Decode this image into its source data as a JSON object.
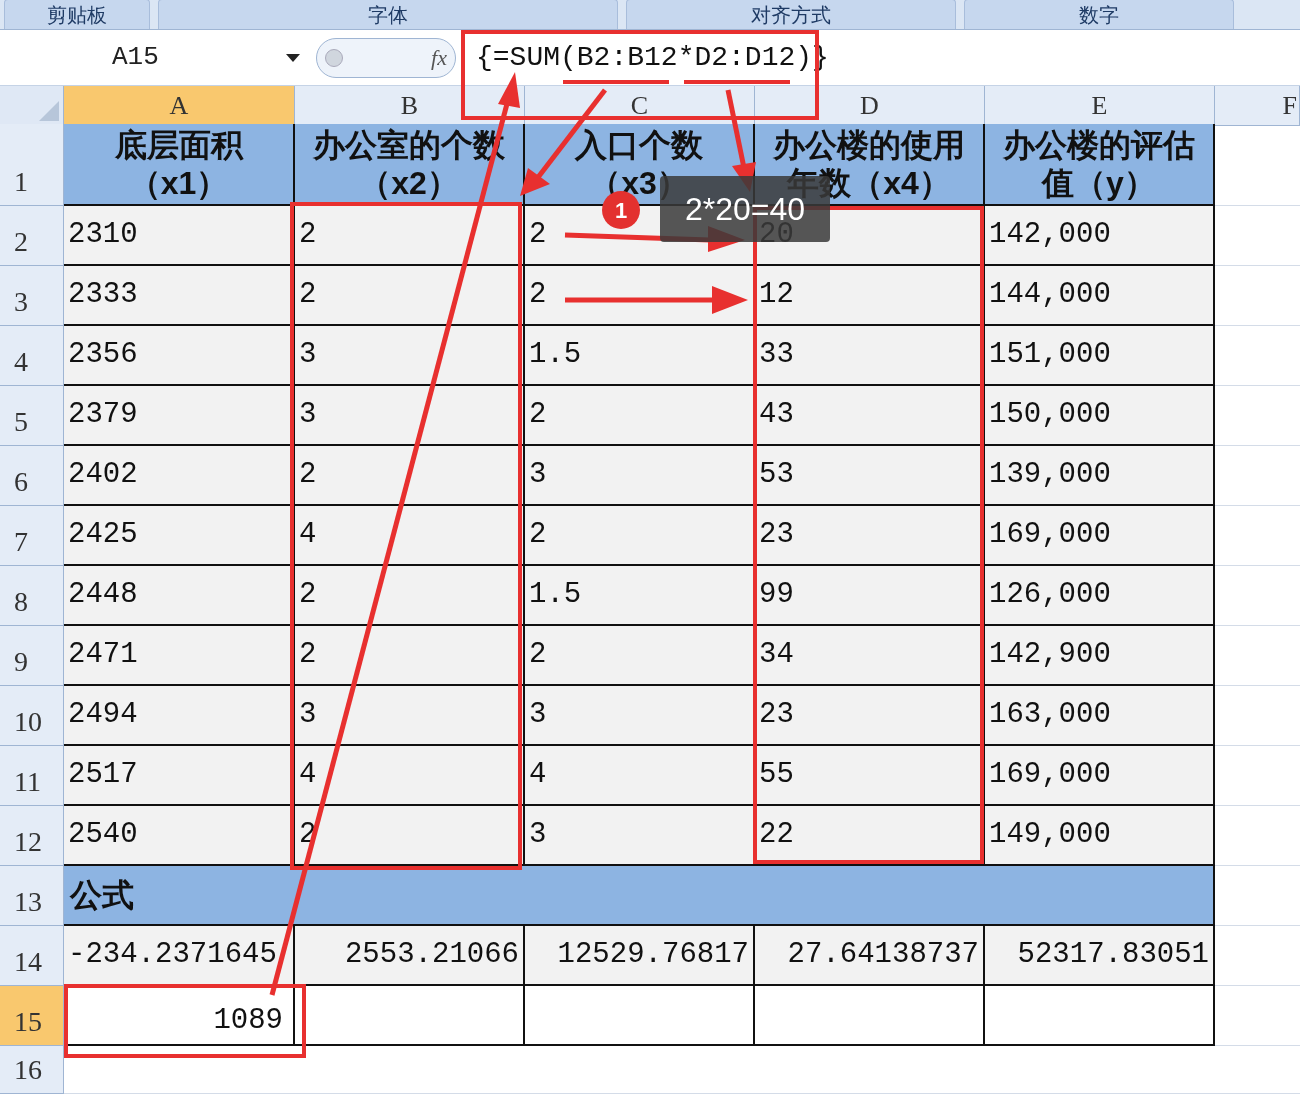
{
  "ribbon_groups": [
    "剪贴板",
    "字体",
    "对齐方式",
    "数字"
  ],
  "name_box": "A15",
  "function_label": "fx",
  "formula": "{=SUM(B2:B12*D2:D12)}",
  "columns": [
    {
      "label": "A",
      "selected": true
    },
    {
      "label": "B",
      "selected": false
    },
    {
      "label": "C",
      "selected": false
    },
    {
      "label": "D",
      "selected": false
    },
    {
      "label": "E",
      "selected": false
    },
    {
      "label": "F",
      "selected": false
    }
  ],
  "rows": [
    {
      "number": "1",
      "selected": false,
      "kind": "header",
      "cells": [
        "底层面积（x1）",
        "办公室的个数（x2）",
        "入口个数（x3）",
        "办公楼的使用年数（x4）",
        "办公楼的评估值（y）"
      ]
    },
    {
      "number": "2",
      "selected": false,
      "kind": "data",
      "cells": [
        "2310",
        "2",
        "2",
        "20",
        "142,000"
      ]
    },
    {
      "number": "3",
      "selected": false,
      "kind": "data",
      "cells": [
        "2333",
        "2",
        "2",
        "12",
        "144,000"
      ]
    },
    {
      "number": "4",
      "selected": false,
      "kind": "data",
      "cells": [
        "2356",
        "3",
        "1.5",
        "33",
        "151,000"
      ]
    },
    {
      "number": "5",
      "selected": false,
      "kind": "data",
      "cells": [
        "2379",
        "3",
        "2",
        "43",
        "150,000"
      ]
    },
    {
      "number": "6",
      "selected": false,
      "kind": "data",
      "cells": [
        "2402",
        "2",
        "3",
        "53",
        "139,000"
      ]
    },
    {
      "number": "7",
      "selected": false,
      "kind": "data",
      "cells": [
        "2425",
        "4",
        "2",
        "23",
        "169,000"
      ]
    },
    {
      "number": "8",
      "selected": false,
      "kind": "data",
      "cells": [
        "2448",
        "2",
        "1.5",
        "99",
        "126,000"
      ]
    },
    {
      "number": "9",
      "selected": false,
      "kind": "data",
      "cells": [
        "2471",
        "2",
        "2",
        "34",
        "142,900"
      ]
    },
    {
      "number": "10",
      "selected": false,
      "kind": "data",
      "cells": [
        "2494",
        "3",
        "3",
        "23",
        "163,000"
      ]
    },
    {
      "number": "11",
      "selected": false,
      "kind": "data",
      "cells": [
        "2517",
        "4",
        "4",
        "55",
        "169,000"
      ]
    },
    {
      "number": "12",
      "selected": false,
      "kind": "data",
      "cells": [
        "2540",
        "2",
        "3",
        "22",
        "149,000"
      ]
    },
    {
      "number": "13",
      "selected": false,
      "kind": "section",
      "text": "公式"
    },
    {
      "number": "14",
      "selected": false,
      "kind": "result",
      "cells": [
        "-234.2371645",
        "2553.21066",
        "12529.76817",
        "27.64138737",
        "52317.83051"
      ]
    },
    {
      "number": "15",
      "selected": true,
      "kind": "answer",
      "value": "1089"
    },
    {
      "number": "16",
      "selected": false,
      "kind": "empty"
    }
  ],
  "callout": {
    "badge": "1",
    "text": "2*20=40"
  }
}
